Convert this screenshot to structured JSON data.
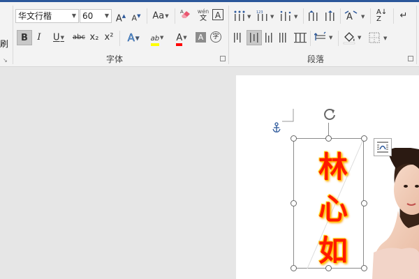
{
  "left_fragment": "刷",
  "font": {
    "name": "华文行楷",
    "size": "60",
    "grow_label": "A",
    "shrink_label": "A",
    "case_label": "Aa",
    "phonetic_top": "wén",
    "phonetic_bottom": "文",
    "border_label": "A",
    "bold_label": "B",
    "italic_label": "I",
    "underline_label": "U",
    "strike_label": "abc",
    "subscript_label": "x₂",
    "superscript_label": "x²",
    "effects_label": "A",
    "highlight_label": "ab",
    "font_color_label": "A",
    "shading_label": "A",
    "enclose_label": "字"
  },
  "paragraph": {
    "sort_label": "A↓",
    "sort_sub": "Z"
  },
  "groups": {
    "font_label": "字体",
    "paragraph_label": "段落"
  },
  "document": {
    "vertical_text": [
      "林",
      "心",
      "如"
    ]
  },
  "colors": {
    "accent": "#2b579a",
    "highlight": "#ffff00",
    "font_color": "#ff0000",
    "text_fill": "#ff1a00",
    "text_glow": "#ffd200"
  }
}
